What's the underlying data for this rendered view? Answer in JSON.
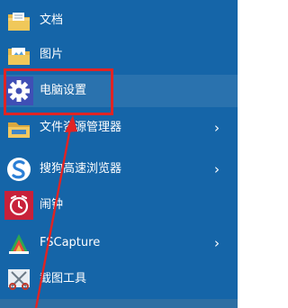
{
  "menu": {
    "items": [
      {
        "label": "文档",
        "icon": "folder-documents-icon",
        "has_submenu": false
      },
      {
        "label": "图片",
        "icon": "folder-pictures-icon",
        "has_submenu": false
      },
      {
        "label": "电脑设置",
        "icon": "gear-icon",
        "has_submenu": false
      },
      {
        "label": "文件资源管理器",
        "icon": "file-explorer-icon",
        "has_submenu": true
      },
      {
        "label": "搜狗高速浏览器",
        "icon": "sogou-browser-icon",
        "has_submenu": true
      },
      {
        "label": "闹钟",
        "icon": "alarm-clock-icon",
        "has_submenu": false
      },
      {
        "label": "FSCapture",
        "icon": "fscapture-icon",
        "has_submenu": true
      },
      {
        "label": "截图工具",
        "icon": "scissors-icon",
        "has_submenu": false
      }
    ],
    "chevron": "›"
  },
  "colors": {
    "panel": "#1565a8",
    "highlight_box": "#e02424",
    "arrow": "#e02424",
    "text": "#ffffff"
  }
}
